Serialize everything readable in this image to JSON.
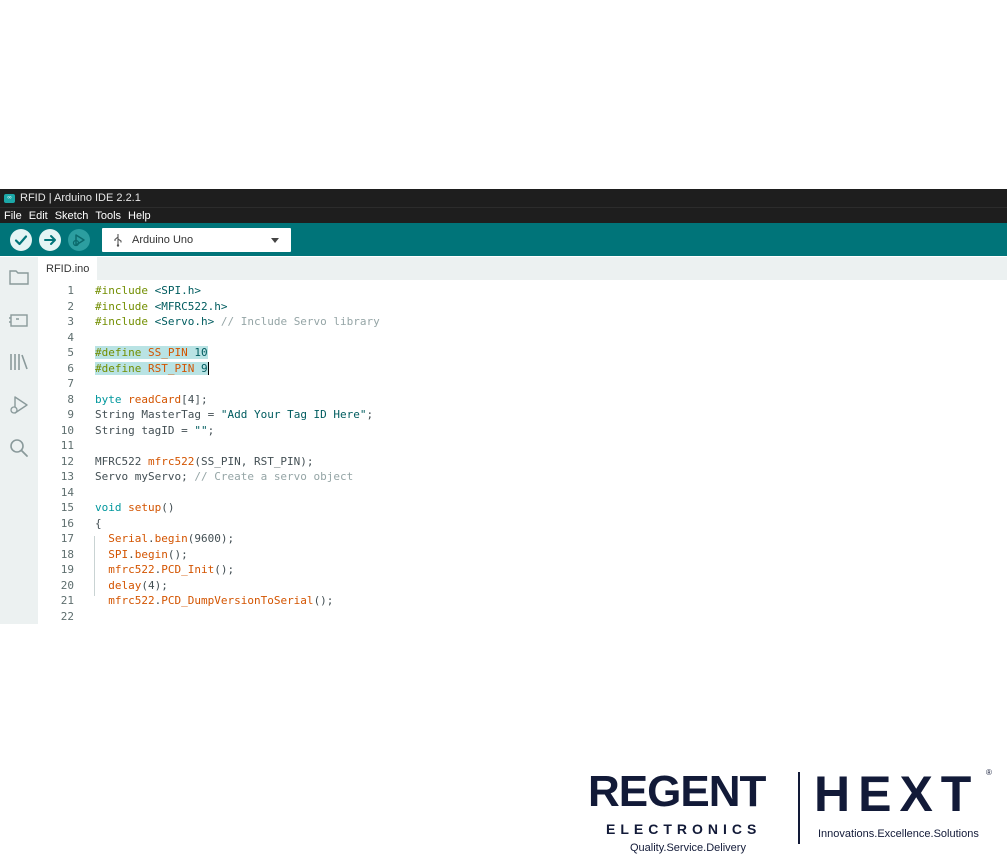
{
  "window": {
    "title": "RFID | Arduino IDE 2.2.1"
  },
  "menu": [
    "File",
    "Edit",
    "Sketch",
    "Tools",
    "Help"
  ],
  "toolbar": {
    "verify_icon": "check-icon",
    "upload_icon": "arrow-right-icon",
    "debug_icon": "debug-icon",
    "board": "Arduino Uno"
  },
  "sidebar": [
    "folder-icon",
    "board-icon",
    "library-icon",
    "debug-icon",
    "search-icon"
  ],
  "tab": {
    "label": "RFID.ino"
  },
  "code": [
    {
      "n": "1",
      "tokens": [
        {
          "t": "#include ",
          "c": "def"
        },
        {
          "t": "<SPI.h>",
          "c": "str"
        }
      ]
    },
    {
      "n": "2",
      "tokens": [
        {
          "t": "#include ",
          "c": "def"
        },
        {
          "t": "<MFRC522.h>",
          "c": "str"
        }
      ]
    },
    {
      "n": "3",
      "tokens": [
        {
          "t": "#include ",
          "c": "def"
        },
        {
          "t": "<Servo.h>",
          "c": "str"
        },
        {
          "t": " // Include Servo library",
          "c": "cmt"
        }
      ]
    },
    {
      "n": "4",
      "tokens": []
    },
    {
      "n": "5",
      "tokens": [
        {
          "t": "#define ",
          "c": "def"
        },
        {
          "t": "SS_PIN ",
          "c": "fn"
        },
        {
          "t": "10",
          "c": "num"
        }
      ],
      "highlight": true
    },
    {
      "n": "6",
      "tokens": [
        {
          "t": "#define ",
          "c": "def"
        },
        {
          "t": "RST_PIN ",
          "c": "fn"
        },
        {
          "t": "9",
          "c": "num"
        }
      ],
      "highlight": true,
      "cursor": true
    },
    {
      "n": "7",
      "tokens": []
    },
    {
      "n": "8",
      "tokens": [
        {
          "t": "byte ",
          "c": "typ"
        },
        {
          "t": "readCard",
          "c": "fn"
        },
        {
          "t": "[4];",
          "c": ""
        }
      ]
    },
    {
      "n": "9",
      "tokens": [
        {
          "t": "String MasterTag = ",
          "c": ""
        },
        {
          "t": "\"Add Your Tag ID Here\"",
          "c": "str"
        },
        {
          "t": ";",
          "c": ""
        }
      ]
    },
    {
      "n": "10",
      "tokens": [
        {
          "t": "String tagID = ",
          "c": ""
        },
        {
          "t": "\"\"",
          "c": "str"
        },
        {
          "t": ";",
          "c": ""
        }
      ]
    },
    {
      "n": "11",
      "tokens": []
    },
    {
      "n": "12",
      "tokens": [
        {
          "t": "MFRC522 ",
          "c": ""
        },
        {
          "t": "mfrc522",
          "c": "fn"
        },
        {
          "t": "(SS_PIN, RST_PIN);",
          "c": ""
        }
      ]
    },
    {
      "n": "13",
      "tokens": [
        {
          "t": "Servo myServo; ",
          "c": ""
        },
        {
          "t": "// Create a servo object",
          "c": "cmt"
        }
      ]
    },
    {
      "n": "14",
      "tokens": []
    },
    {
      "n": "15",
      "tokens": [
        {
          "t": "void ",
          "c": "kw"
        },
        {
          "t": "setup",
          "c": "fn"
        },
        {
          "t": "()",
          "c": ""
        }
      ]
    },
    {
      "n": "16",
      "tokens": [
        {
          "t": "{",
          "c": ""
        }
      ]
    },
    {
      "n": "17",
      "tokens": [
        {
          "t": "  ",
          "c": ""
        },
        {
          "t": "Serial",
          "c": "fn"
        },
        {
          "t": ".",
          "c": ""
        },
        {
          "t": "begin",
          "c": "fn"
        },
        {
          "t": "(9600);",
          "c": ""
        }
      ]
    },
    {
      "n": "18",
      "tokens": [
        {
          "t": "  ",
          "c": ""
        },
        {
          "t": "SPI",
          "c": "fn"
        },
        {
          "t": ".",
          "c": ""
        },
        {
          "t": "begin",
          "c": "fn"
        },
        {
          "t": "();",
          "c": ""
        }
      ]
    },
    {
      "n": "19",
      "tokens": [
        {
          "t": "  ",
          "c": ""
        },
        {
          "t": "mfrc522",
          "c": "fn"
        },
        {
          "t": ".",
          "c": ""
        },
        {
          "t": "PCD_Init",
          "c": "fn"
        },
        {
          "t": "();",
          "c": ""
        }
      ]
    },
    {
      "n": "20",
      "tokens": [
        {
          "t": "  ",
          "c": ""
        },
        {
          "t": "delay",
          "c": "fn"
        },
        {
          "t": "(4);",
          "c": ""
        }
      ]
    },
    {
      "n": "21",
      "tokens": [
        {
          "t": "  ",
          "c": ""
        },
        {
          "t": "mfrc522",
          "c": "fn"
        },
        {
          "t": ".",
          "c": ""
        },
        {
          "t": "PCD_DumpVersionToSerial",
          "c": "fn"
        },
        {
          "t": "();",
          "c": ""
        }
      ]
    },
    {
      "n": "22",
      "tokens": []
    }
  ],
  "logo": {
    "brand1": "REGENT",
    "brand1_sub": "ELECTRONICS",
    "tagline1": "Quality.Service.Delivery",
    "brand2": "HEXT",
    "registered": "®",
    "tagline2": "Innovations.Excellence.Solutions",
    "color": "#121a38"
  },
  "colors": {
    "toolbar": "#007479",
    "titlebar": "#1e1e1e",
    "highlight": "#b9e3e4"
  }
}
